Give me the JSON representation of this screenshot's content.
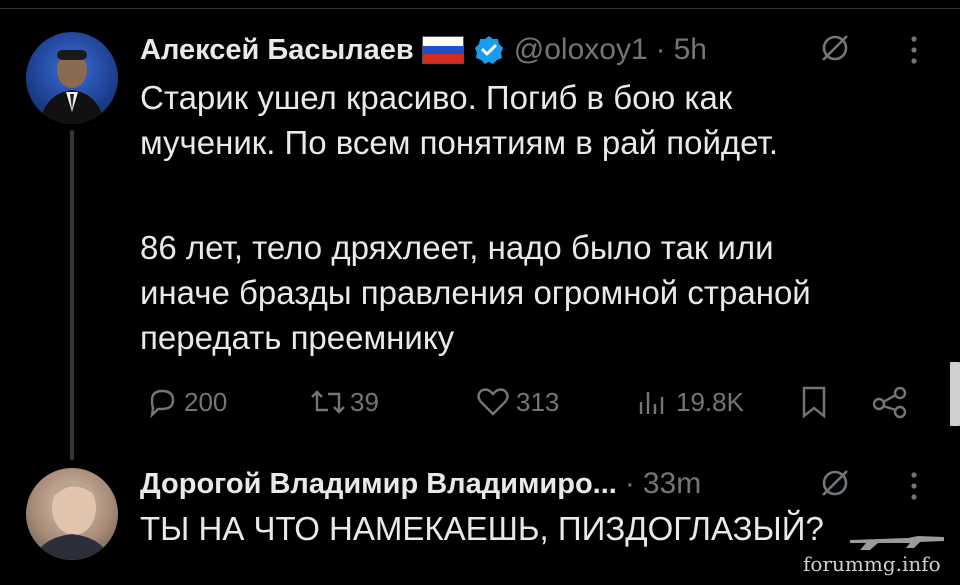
{
  "tweet": {
    "author_name": "Алексей Басылаев",
    "flag_icon": "russia-flag-icon",
    "verified_icon": "verified-badge-icon",
    "verified_color": "#1d9bf0",
    "handle": "@oloxoy1",
    "separator": "·",
    "time": "5h",
    "text_lines_1": [
      "Старик ушел красиво. Погиб в бою как",
      "мученик. По всем понятиям в рай пойдет."
    ],
    "text_lines_2": [
      "86 лет, тело дряхлеет, надо было так или",
      "иначе бразды правления огромной страной",
      "передать преемнику"
    ],
    "actions": {
      "replies": "200",
      "retweets": "39",
      "likes": "313",
      "views": "19.8K"
    }
  },
  "reply": {
    "author_name": "Дорогой Владимир Владимиро...",
    "separator": "·",
    "time": "33m",
    "text": "ТЫ НА ЧТО НАМЕКАЕШЬ, ПИЗДОГЛАЗЫЙ?"
  },
  "watermark": {
    "text": "forummg.info"
  },
  "colors": {
    "background": "#000000",
    "text": "#e7e9ea",
    "muted": "#71767b",
    "thread_line": "#333639"
  }
}
